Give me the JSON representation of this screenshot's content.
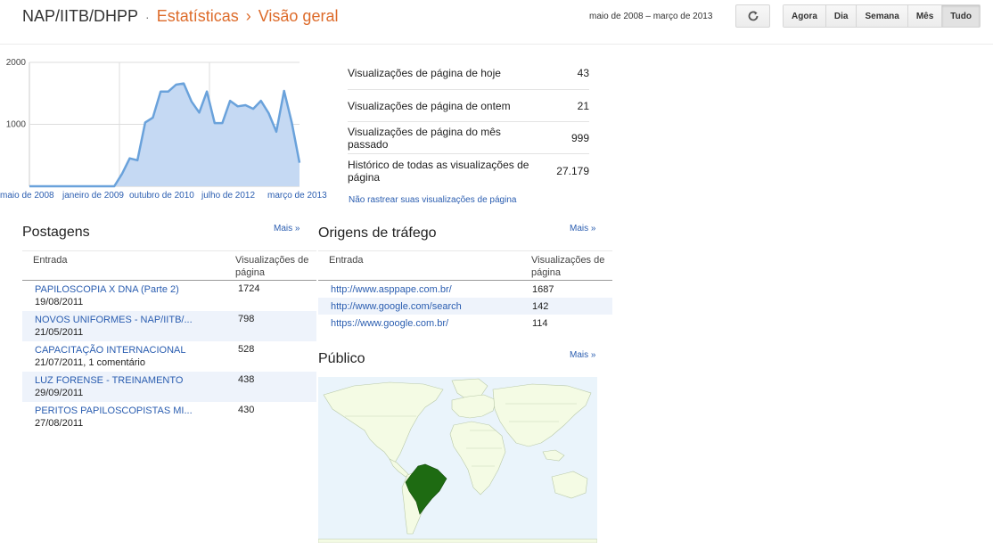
{
  "header": {
    "blog_name": "NAP/IITB/DHPP",
    "separator": "·",
    "breadcrumb_1": "Estatísticas",
    "breadcrumb_arrow": "›",
    "breadcrumb_2": "Visão geral",
    "date_range": "maio de 2008 – março de 2013",
    "refresh_icon": "refresh-icon",
    "ranges": [
      "Agora",
      "Dia",
      "Semana",
      "Mês",
      "Tudo"
    ],
    "active_range": "Tudo"
  },
  "chart_data": {
    "type": "area",
    "ylim": [
      0,
      2000
    ],
    "y_ticks": [
      2000,
      1000
    ],
    "x_tick_labels": [
      "maio de 2008",
      "janeiro de 2009",
      "outubro de 2010",
      "julho de 2012",
      "março de 2013"
    ],
    "values": [
      0,
      0,
      0,
      0,
      0,
      0,
      0,
      0,
      0,
      0,
      0,
      0,
      200,
      450,
      420,
      1030,
      1110,
      1530,
      1530,
      1640,
      1660,
      1370,
      1190,
      1530,
      1020,
      1020,
      1380,
      1290,
      1310,
      1250,
      1380,
      1180,
      880,
      1540,
      1030,
      380
    ],
    "line_color": "#6aa2db",
    "fill_color": "#c5d9f3"
  },
  "stats": [
    {
      "label": "Visualizações de página de hoje",
      "value": "43"
    },
    {
      "label": "Visualizações de página de ontem",
      "value": "21"
    },
    {
      "label": "Visualizações de página do mês passado",
      "value": "999"
    },
    {
      "label": "Histórico de todas as visualizações de página",
      "value": "27.179"
    }
  ],
  "no_track_link": "Não rastrear suas visualizações de página",
  "postagens": {
    "title": "Postagens",
    "more": "Mais »",
    "col_entry": "Entrada",
    "col_views": "Visualizações de página",
    "rows": [
      {
        "title": "PAPILOSCOPIA X DNA (Parte 2)",
        "sub": "19/08/2011",
        "views": "1724"
      },
      {
        "title": "NOVOS UNIFORMES - NAP/IITB/...",
        "sub": "21/05/2011",
        "views": "798"
      },
      {
        "title": "CAPACITAÇÃO INTERNACIONAL",
        "sub": "21/07/2011, 1 comentário",
        "views": "528"
      },
      {
        "title": "LUZ FORENSE - TREINAMENTO",
        "sub": "29/09/2011",
        "views": "438"
      },
      {
        "title": "PERITOS PAPILOSCOPISTAS MI...",
        "sub": "27/08/2011",
        "views": "430"
      }
    ]
  },
  "trafego": {
    "title": "Origens de tráfego",
    "more": "Mais »",
    "col_entry": "Entrada",
    "col_views": "Visualizações de página",
    "rows": [
      {
        "url": "http://www.asppape.com.br/",
        "views": "1687"
      },
      {
        "url": "http://www.google.com/search",
        "views": "142"
      },
      {
        "url": "https://www.google.com.br/",
        "views": "114"
      }
    ]
  },
  "publico": {
    "title": "Público",
    "more": "Mais »",
    "ocean_color": "#eaf4fb",
    "land_color": "#f4fbe4",
    "highlight_color": "#1e6b12"
  }
}
